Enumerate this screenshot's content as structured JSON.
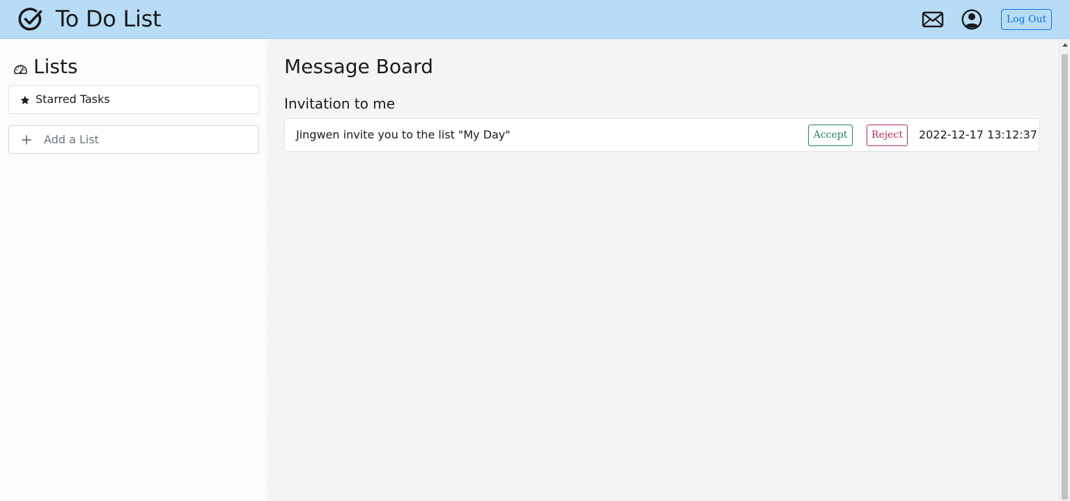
{
  "header": {
    "title": "To Do List",
    "brand_icon": "check-circle-icon",
    "mail_icon": "envelope-icon",
    "user_icon": "person-circle-icon",
    "logout_label": "Log Out",
    "background_color": "#b8dcf5"
  },
  "sidebar": {
    "title": "Lists",
    "title_icon": "speedometer-icon",
    "lists": [
      {
        "label": "Starred Tasks",
        "icon": "star-icon"
      }
    ],
    "add_list_placeholder": "Add a List",
    "add_list_icon": "plus-icon"
  },
  "main": {
    "title": "Message Board",
    "section_title": "Invitation to me",
    "invitations": [
      {
        "message": "Jingwen invite you to the list \"My Day\"",
        "accept_label": "Accept",
        "reject_label": "Reject",
        "time": "2022-12-17 13:12:37"
      }
    ]
  },
  "colors": {
    "accept": "#198754",
    "reject": "#c0294c",
    "logout": "#0d6efd"
  }
}
